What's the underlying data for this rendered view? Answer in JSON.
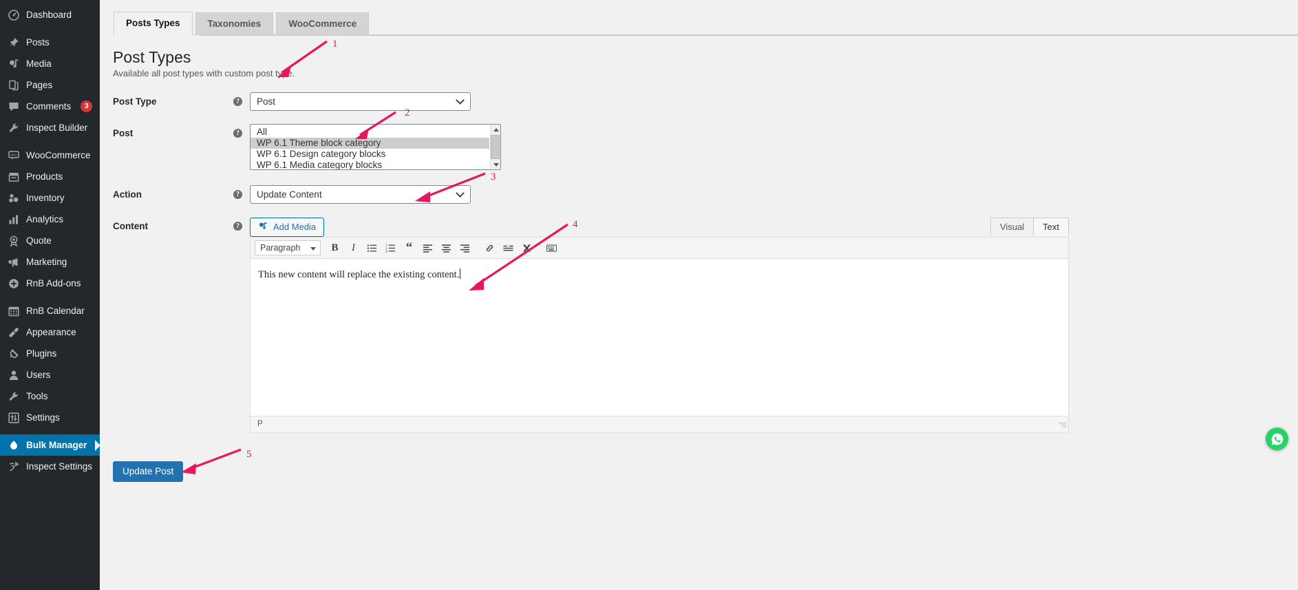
{
  "sidebar": {
    "items": [
      {
        "label": "Dashboard",
        "icon": "dashboard-icon",
        "group": 0
      },
      {
        "label": "Posts",
        "icon": "pin-icon",
        "group": 1
      },
      {
        "label": "Media",
        "icon": "media-icon",
        "group": 1
      },
      {
        "label": "Pages",
        "icon": "pages-icon",
        "group": 1
      },
      {
        "label": "Comments",
        "icon": "comment-icon",
        "group": 1,
        "badge": "3"
      },
      {
        "label": "Inspect Builder",
        "icon": "wrench-icon",
        "group": 1
      },
      {
        "label": "WooCommerce",
        "icon": "woo-icon",
        "group": 2
      },
      {
        "label": "Products",
        "icon": "products-icon",
        "group": 2
      },
      {
        "label": "Inventory",
        "icon": "inventory-icon",
        "group": 2
      },
      {
        "label": "Analytics",
        "icon": "analytics-icon",
        "group": 2
      },
      {
        "label": "Quote",
        "icon": "quote-award-icon",
        "group": 2
      },
      {
        "label": "Marketing",
        "icon": "megaphone-icon",
        "group": 2
      },
      {
        "label": "RnB Add-ons",
        "icon": "plus-circle-icon",
        "group": 2
      },
      {
        "label": "RnB Calendar",
        "icon": "calendar-icon",
        "group": 3
      },
      {
        "label": "Appearance",
        "icon": "paintbrush-icon",
        "group": 3
      },
      {
        "label": "Plugins",
        "icon": "plug-icon",
        "group": 3
      },
      {
        "label": "Users",
        "icon": "user-icon",
        "group": 3
      },
      {
        "label": "Tools",
        "icon": "tools-wrench-icon",
        "group": 3
      },
      {
        "label": "Settings",
        "icon": "settings-sliders-icon",
        "group": 3
      },
      {
        "label": "Bulk Manager",
        "icon": "bulk-manager-icon",
        "group": 4,
        "active": true
      },
      {
        "label": "Inspect Settings",
        "icon": "inspect-settings-icon",
        "group": 4
      }
    ]
  },
  "tabs": [
    {
      "label": "Posts Types",
      "active": true
    },
    {
      "label": "Taxonomies",
      "active": false
    },
    {
      "label": "WooCommerce",
      "active": false
    }
  ],
  "page": {
    "title": "Post Types",
    "subtitle": "Available all post types with custom post type."
  },
  "form": {
    "post_type": {
      "label": "Post Type",
      "value": "Post",
      "help": "?"
    },
    "post": {
      "label": "Post",
      "help": "?",
      "options": [
        {
          "label": "All",
          "selected": false
        },
        {
          "label": "WP 6.1 Theme block category",
          "selected": true
        },
        {
          "label": "WP 6.1 Design category blocks",
          "selected": false
        },
        {
          "label": "WP 6.1 Media category blocks",
          "selected": false
        }
      ]
    },
    "action": {
      "label": "Action",
      "value": "Update Content",
      "help": "?"
    },
    "content": {
      "label": "Content",
      "help": "?",
      "add_media_label": "Add Media",
      "view_tabs": [
        {
          "label": "Visual",
          "active": false
        },
        {
          "label": "Text",
          "active": true
        }
      ],
      "format_select": "Paragraph",
      "toolbar": [
        {
          "name": "bold-icon",
          "glyph": "B"
        },
        {
          "name": "italic-icon",
          "glyph": "I"
        },
        {
          "name": "bulleted-list-icon",
          "glyph": ""
        },
        {
          "name": "numbered-list-icon",
          "glyph": ""
        },
        {
          "name": "blockquote-icon",
          "glyph": "“"
        },
        {
          "name": "align-left-icon",
          "glyph": ""
        },
        {
          "name": "align-center-icon",
          "glyph": ""
        },
        {
          "name": "align-right-icon",
          "glyph": ""
        },
        {
          "name": "insert-link-icon",
          "glyph": ""
        },
        {
          "name": "insert-read-more-icon",
          "glyph": ""
        },
        {
          "name": "toolbar-toggle-icon",
          "glyph": ""
        },
        {
          "name": "keyboard-shortcuts-icon",
          "glyph": ""
        }
      ],
      "body_text": "This new content will replace the existing content.",
      "status_path": "P"
    }
  },
  "submit": {
    "label": "Update Post"
  },
  "annotations": [
    {
      "number": "1"
    },
    {
      "number": "2"
    },
    {
      "number": "3"
    },
    {
      "number": "4"
    },
    {
      "number": "5"
    }
  ],
  "chat_widget": {
    "name": "whatsapp-chat-button",
    "color": "#25d366"
  },
  "colors": {
    "sidebar_bg": "#23282d",
    "accent_blue": "#0073aa",
    "button_blue": "#2271b1",
    "annotation_pink": "#e8175d",
    "badge_red": "#d63638"
  }
}
